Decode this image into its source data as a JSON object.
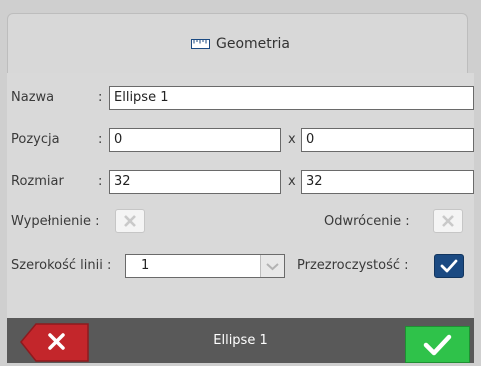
{
  "tab": {
    "title": "Geometria",
    "icon": "ruler-icon"
  },
  "form": {
    "name_label": "Nazwa",
    "name_sep": ":",
    "name_value": "Ellipse 1",
    "position_label": "Pozycja",
    "position_sep": ":",
    "position_x": "0",
    "position_y": "0",
    "size_label": "Rozmiar",
    "size_sep": ":",
    "size_w": "32",
    "size_h": "32",
    "x_sep": "x",
    "fill_label": "Wypełnienie :",
    "fill_checked": false,
    "invert_label": "Odwrócenie :",
    "invert_checked": false,
    "line_width_label": "Szerokość linii :",
    "line_width_value": "1",
    "transparency_label": "Przezroczystość :",
    "transparency_checked": true
  },
  "footer": {
    "title": "Ellipse 1"
  },
  "colors": {
    "accent_blue": "#1b4a82",
    "ok_green": "#2fc24a",
    "cancel_red": "#c3262b",
    "bar": "#595959"
  }
}
